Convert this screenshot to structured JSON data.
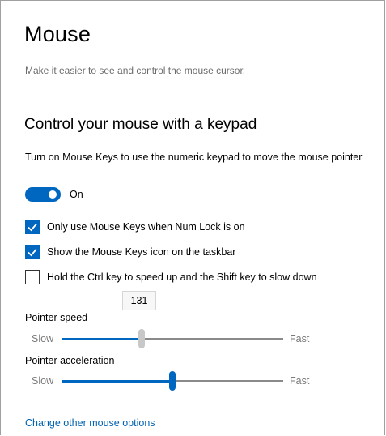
{
  "page": {
    "title": "Mouse",
    "subtitle": "Make it easier to see and control the mouse cursor."
  },
  "section": {
    "title": "Control your mouse with a keypad",
    "description": "Turn on Mouse Keys to use the numeric keypad to move the mouse pointer"
  },
  "toggle": {
    "state": "on",
    "label": "On",
    "color": "#0067c0"
  },
  "checkboxes": [
    {
      "label": "Only use Mouse Keys when Num Lock is on",
      "checked": true
    },
    {
      "label": "Show the Mouse Keys icon on the taskbar",
      "checked": true
    },
    {
      "label": "Hold the Ctrl key to speed up and the Shift key to slow down",
      "checked": false
    }
  ],
  "pointer_speed": {
    "title": "Pointer speed",
    "value_display": "131",
    "min_label": "Slow",
    "max_label": "Fast",
    "fraction": 0.36,
    "thumb_color": "#c8c8c8",
    "fill_color": "#0067c0"
  },
  "pointer_acceleration": {
    "title": "Pointer acceleration",
    "min_label": "Slow",
    "max_label": "Fast",
    "fraction": 0.5,
    "thumb_color": "#0067c0",
    "fill_color": "#0067c0"
  },
  "link": {
    "label": "Change other mouse options"
  },
  "colors": {
    "accent": "#0067c0",
    "link": "#0063b1",
    "secondary_text": "#6b6b6b"
  }
}
